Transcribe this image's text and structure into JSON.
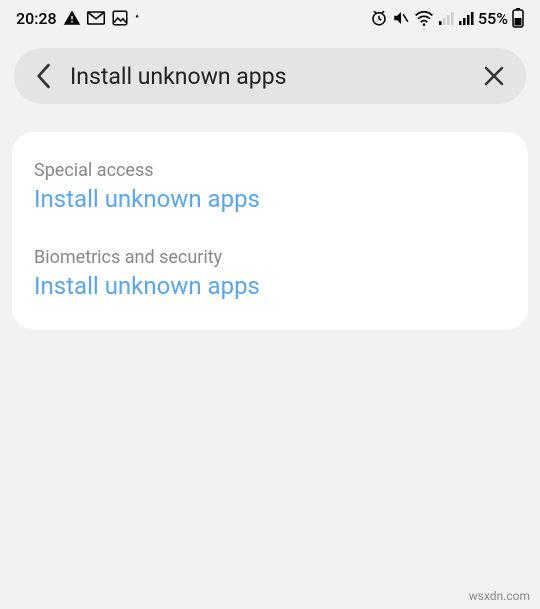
{
  "status": {
    "time": "20:28",
    "battery_pct": "55%"
  },
  "search": {
    "query": "Install unknown apps"
  },
  "results": [
    {
      "category": "Special access",
      "title": "Install unknown apps"
    },
    {
      "category": "Biometrics and security",
      "title": "Install unknown apps"
    }
  ],
  "watermark": "wsxdn.com",
  "colors": {
    "link": "#5aa6e8",
    "bg": "#f2f2f2",
    "card": "#ffffff",
    "searchbar": "#e4e4e4"
  }
}
